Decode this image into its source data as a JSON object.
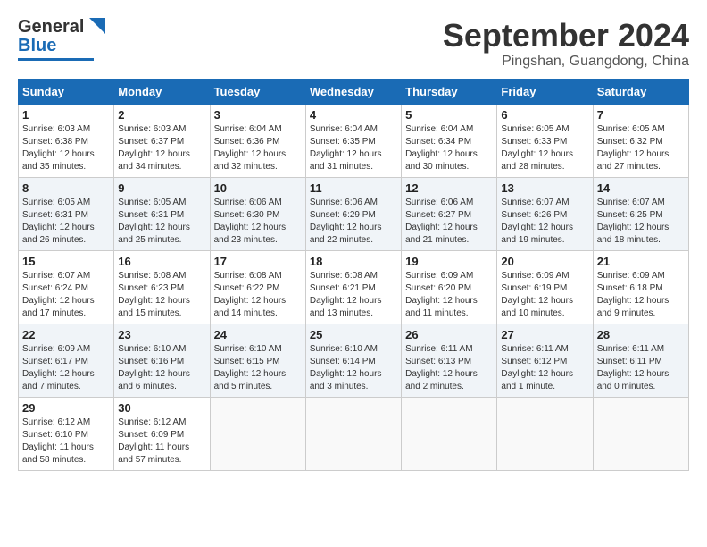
{
  "header": {
    "logo_line1": "General",
    "logo_line2": "Blue",
    "title": "September 2024",
    "subtitle": "Pingshan, Guangdong, China"
  },
  "calendar": {
    "days_of_week": [
      "Sunday",
      "Monday",
      "Tuesday",
      "Wednesday",
      "Thursday",
      "Friday",
      "Saturday"
    ],
    "weeks": [
      [
        null,
        {
          "day": "2",
          "info": "Sunrise: 6:03 AM\nSunset: 6:37 PM\nDaylight: 12 hours\nand 34 minutes."
        },
        {
          "day": "3",
          "info": "Sunrise: 6:04 AM\nSunset: 6:36 PM\nDaylight: 12 hours\nand 32 minutes."
        },
        {
          "day": "4",
          "info": "Sunrise: 6:04 AM\nSunset: 6:35 PM\nDaylight: 12 hours\nand 31 minutes."
        },
        {
          "day": "5",
          "info": "Sunrise: 6:04 AM\nSunset: 6:34 PM\nDaylight: 12 hours\nand 30 minutes."
        },
        {
          "day": "6",
          "info": "Sunrise: 6:05 AM\nSunset: 6:33 PM\nDaylight: 12 hours\nand 28 minutes."
        },
        {
          "day": "7",
          "info": "Sunrise: 6:05 AM\nSunset: 6:32 PM\nDaylight: 12 hours\nand 27 minutes."
        }
      ],
      [
        {
          "day": "1",
          "info": "Sunrise: 6:03 AM\nSunset: 6:38 PM\nDaylight: 12 hours\nand 35 minutes."
        },
        {
          "day": "9",
          "info": "Sunrise: 6:05 AM\nSunset: 6:31 PM\nDaylight: 12 hours\nand 25 minutes."
        },
        {
          "day": "10",
          "info": "Sunrise: 6:06 AM\nSunset: 6:30 PM\nDaylight: 12 hours\nand 23 minutes."
        },
        {
          "day": "11",
          "info": "Sunrise: 6:06 AM\nSunset: 6:29 PM\nDaylight: 12 hours\nand 22 minutes."
        },
        {
          "day": "12",
          "info": "Sunrise: 6:06 AM\nSunset: 6:27 PM\nDaylight: 12 hours\nand 21 minutes."
        },
        {
          "day": "13",
          "info": "Sunrise: 6:07 AM\nSunset: 6:26 PM\nDaylight: 12 hours\nand 19 minutes."
        },
        {
          "day": "14",
          "info": "Sunrise: 6:07 AM\nSunset: 6:25 PM\nDaylight: 12 hours\nand 18 minutes."
        }
      ],
      [
        {
          "day": "8",
          "info": "Sunrise: 6:05 AM\nSunset: 6:31 PM\nDaylight: 12 hours\nand 26 minutes."
        },
        {
          "day": "16",
          "info": "Sunrise: 6:08 AM\nSunset: 6:23 PM\nDaylight: 12 hours\nand 15 minutes."
        },
        {
          "day": "17",
          "info": "Sunrise: 6:08 AM\nSunset: 6:22 PM\nDaylight: 12 hours\nand 14 minutes."
        },
        {
          "day": "18",
          "info": "Sunrise: 6:08 AM\nSunset: 6:21 PM\nDaylight: 12 hours\nand 13 minutes."
        },
        {
          "day": "19",
          "info": "Sunrise: 6:09 AM\nSunset: 6:20 PM\nDaylight: 12 hours\nand 11 minutes."
        },
        {
          "day": "20",
          "info": "Sunrise: 6:09 AM\nSunset: 6:19 PM\nDaylight: 12 hours\nand 10 minutes."
        },
        {
          "day": "21",
          "info": "Sunrise: 6:09 AM\nSunset: 6:18 PM\nDaylight: 12 hours\nand 9 minutes."
        }
      ],
      [
        {
          "day": "15",
          "info": "Sunrise: 6:07 AM\nSunset: 6:24 PM\nDaylight: 12 hours\nand 17 minutes."
        },
        {
          "day": "23",
          "info": "Sunrise: 6:10 AM\nSunset: 6:16 PM\nDaylight: 12 hours\nand 6 minutes."
        },
        {
          "day": "24",
          "info": "Sunrise: 6:10 AM\nSunset: 6:15 PM\nDaylight: 12 hours\nand 5 minutes."
        },
        {
          "day": "25",
          "info": "Sunrise: 6:10 AM\nSunset: 6:14 PM\nDaylight: 12 hours\nand 3 minutes."
        },
        {
          "day": "26",
          "info": "Sunrise: 6:11 AM\nSunset: 6:13 PM\nDaylight: 12 hours\nand 2 minutes."
        },
        {
          "day": "27",
          "info": "Sunrise: 6:11 AM\nSunset: 6:12 PM\nDaylight: 12 hours\nand 1 minute."
        },
        {
          "day": "28",
          "info": "Sunrise: 6:11 AM\nSunset: 6:11 PM\nDaylight: 12 hours\nand 0 minutes."
        }
      ],
      [
        {
          "day": "22",
          "info": "Sunrise: 6:09 AM\nSunset: 6:17 PM\nDaylight: 12 hours\nand 7 minutes."
        },
        {
          "day": "30",
          "info": "Sunrise: 6:12 AM\nSunset: 6:09 PM\nDaylight: 11 hours\nand 57 minutes."
        },
        null,
        null,
        null,
        null,
        null
      ],
      [
        {
          "day": "29",
          "info": "Sunrise: 6:12 AM\nSunset: 6:10 PM\nDaylight: 11 hours\nand 58 minutes."
        },
        null,
        null,
        null,
        null,
        null,
        null
      ]
    ]
  }
}
